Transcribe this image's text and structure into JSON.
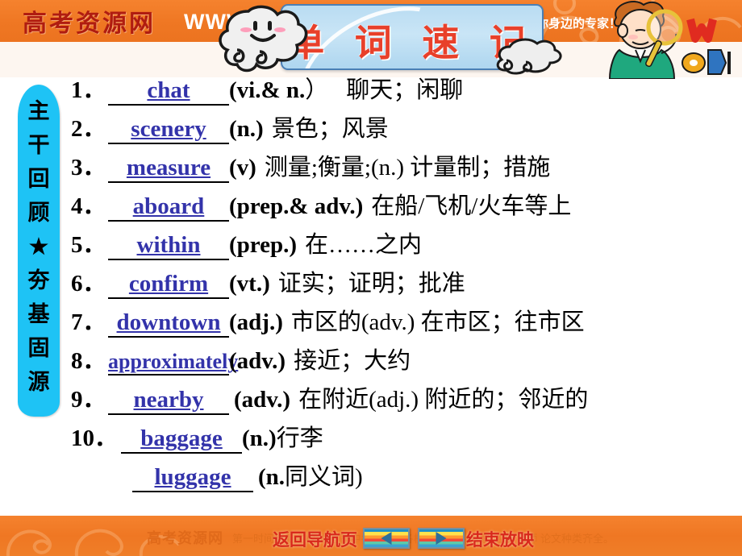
{
  "banner": {
    "brand": "高考资源网",
    "www": "WWW",
    "tagline": "网-你身边的专家！】",
    "title": "单 词 速 记",
    "icons": {
      "cloud_big": "cloud-smiling-icon",
      "cloud_small": "cloud-icon",
      "boy": "boy-with-magnifier-icon",
      "swirl": "swirl-ornament-icon"
    }
  },
  "sidebar": {
    "label": "主干回顾★夯基固源",
    "chars": [
      "主",
      "干",
      "回",
      "顾",
      "★",
      "夯",
      "基",
      "固",
      "源"
    ],
    "color": "#1EC3F5"
  },
  "word_list": [
    {
      "num": "1．",
      "word": "chat",
      "pos": "(vi.& n.",
      "pos_tail": "）",
      "meaning": "聊天；闲聊"
    },
    {
      "num": "2．",
      "word": "scenery",
      "pos": "(n.)",
      "pos_tail": "",
      "meaning": "景色；风景"
    },
    {
      "num": "3．",
      "word": "measure",
      "pos": "(v)",
      "pos_tail": "",
      "meaning": "测量;衡量;(n.) 计量制；措施"
    },
    {
      "num": "4．",
      "word": "aboard",
      "pos": "(prep.& adv.)",
      "pos_tail": "",
      "meaning": "在船/飞机/火车等上"
    },
    {
      "num": "5．",
      "word": "within",
      "pos": "(prep.)",
      "pos_tail": "",
      "meaning": "在……之内"
    },
    {
      "num": "6．",
      "word": "confirm",
      "pos": "(vt.)",
      "pos_tail": "",
      "meaning": "证实；证明；批准"
    },
    {
      "num": "7．",
      "word": "downtown",
      "pos": "(adj.)",
      "pos_tail": "",
      "meaning": "市区的(adv.) 在市区；往市区"
    },
    {
      "num": "8．",
      "word": "approximately",
      "pos": "(adv.)",
      "pos_tail": "",
      "meaning": "接近；大约"
    },
    {
      "num": "9．",
      "word": "nearby",
      "pos": "(adv.)",
      "pos_tail": "",
      "meaning": "在附近(adj.) 附近的；邻近的"
    },
    {
      "num": "10．",
      "word": "baggage",
      "pos": "(n.)",
      "pos_tail": "",
      "meaning": "行李"
    },
    {
      "num": "",
      "word": "luggage",
      "pos": "(n.",
      "pos_tail": "",
      "meaning": "同义词)"
    }
  ],
  "bottom": {
    "brand": "高考资源网",
    "sub": "第一时间更新名校试题  高中各市各区各校打包试卷  名家  名校  名师  论文种类齐全。",
    "right": "论文种类齐全。",
    "nav_home": "返回导航页",
    "nav_end": "结束放映",
    "prev_icon": "previous-slide-icon",
    "next_icon": "next-slide-icon"
  },
  "colors": {
    "banner_orange": "#EF7723",
    "title_red": "#E8402A",
    "word_blue": "#3333AA",
    "sidebar_cyan": "#1EC3F5",
    "plaque_blue": "#BEDFF3"
  }
}
